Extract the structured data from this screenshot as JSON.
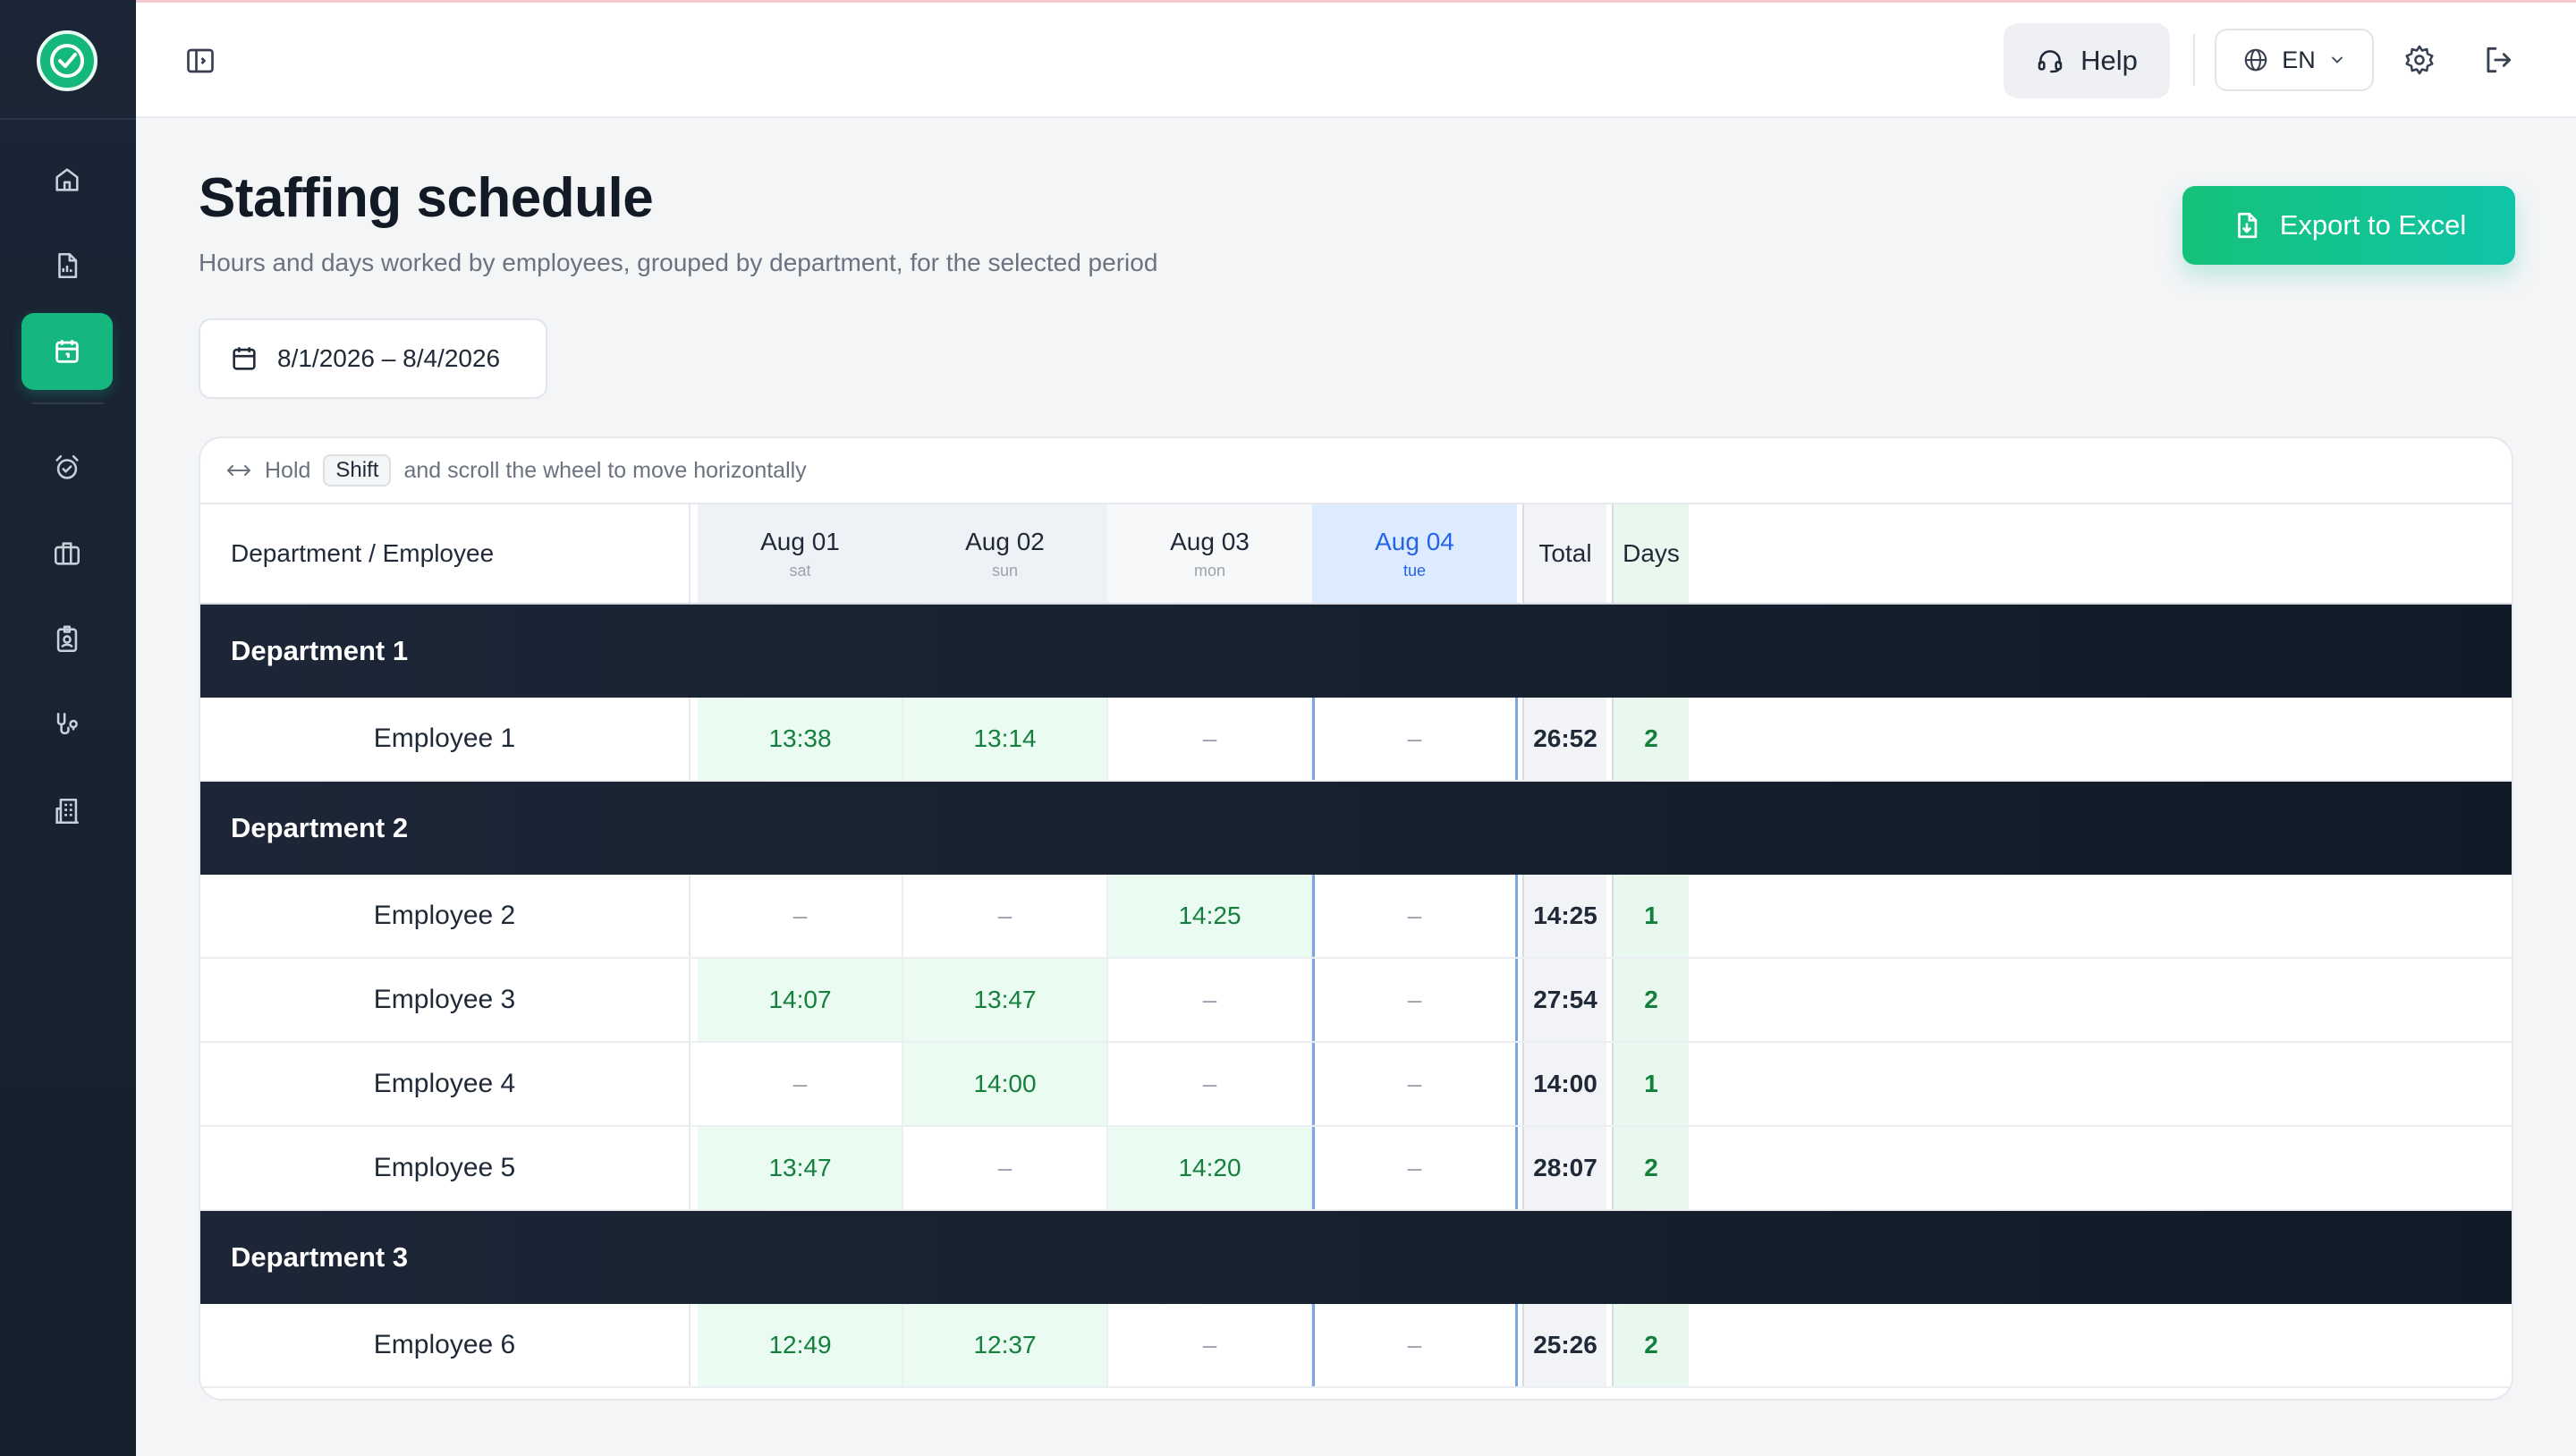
{
  "app": {
    "accent": "#15b77e",
    "sidebar_bg": "#1b2535"
  },
  "sidebar": {
    "items": [
      {
        "icon": "home-icon"
      },
      {
        "icon": "report-icon"
      },
      {
        "icon": "calendar-icon",
        "active": true
      },
      {
        "icon": "alarm-clock-icon"
      },
      {
        "icon": "briefcase-icon"
      },
      {
        "icon": "badge-icon"
      },
      {
        "icon": "stethoscope-icon"
      },
      {
        "icon": "building-icon"
      }
    ]
  },
  "topbar": {
    "help_label": "Help",
    "language": "EN"
  },
  "page": {
    "title": "Staffing schedule",
    "subtitle": "Hours and days worked by employees, grouped by department, for the selected period",
    "export_label": "Export to Excel",
    "date_range": "8/1/2026 – 8/4/2026"
  },
  "table": {
    "hint_prefix": "Hold",
    "hint_key": "Shift",
    "hint_suffix": "and scroll the wheel to move horizontally",
    "name_header": "Department / Employee",
    "total_header": "Total",
    "days_header": "Days",
    "days": [
      {
        "date": "Aug 01",
        "weekday": "sat",
        "kind": "weekend"
      },
      {
        "date": "Aug 02",
        "weekday": "sun",
        "kind": "weekend"
      },
      {
        "date": "Aug 03",
        "weekday": "mon",
        "kind": "plain"
      },
      {
        "date": "Aug 04",
        "weekday": "tue",
        "kind": "today"
      }
    ],
    "departments": [
      {
        "name": "Department 1",
        "employees": [
          {
            "name": "Employee 1",
            "values": [
              "13:38",
              "13:14",
              "–",
              "–"
            ],
            "total": "26:52",
            "days": "2"
          }
        ]
      },
      {
        "name": "Department 2",
        "employees": [
          {
            "name": "Employee 2",
            "values": [
              "–",
              "–",
              "14:25",
              "–"
            ],
            "total": "14:25",
            "days": "1"
          },
          {
            "name": "Employee 3",
            "values": [
              "14:07",
              "13:47",
              "–",
              "–"
            ],
            "total": "27:54",
            "days": "2"
          },
          {
            "name": "Employee 4",
            "values": [
              "–",
              "14:00",
              "–",
              "–"
            ],
            "total": "14:00",
            "days": "1"
          },
          {
            "name": "Employee 5",
            "values": [
              "13:47",
              "–",
              "14:20",
              "–"
            ],
            "total": "28:07",
            "days": "2"
          }
        ]
      },
      {
        "name": "Department 3",
        "employees": [
          {
            "name": "Employee 6",
            "values": [
              "12:49",
              "12:37",
              "–",
              "–"
            ],
            "total": "25:26",
            "days": "2"
          }
        ]
      }
    ]
  }
}
